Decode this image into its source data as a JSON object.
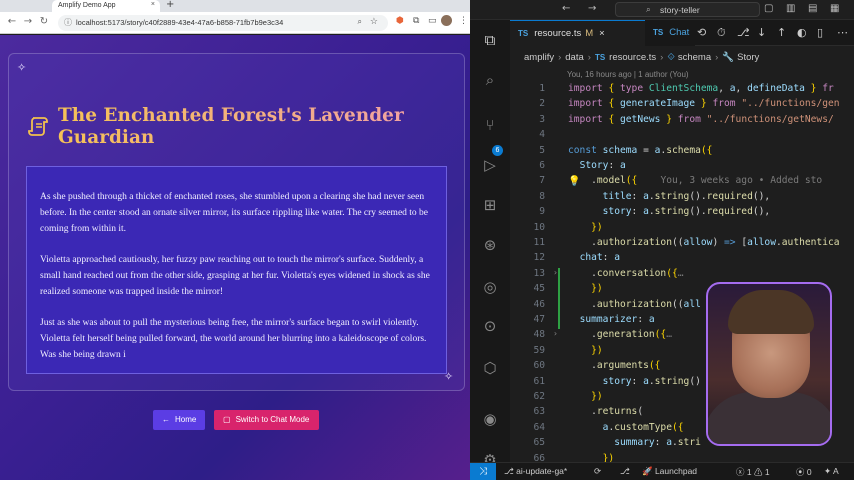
{
  "browser": {
    "tab_title": "Amplify Demo App",
    "tab_close": "×",
    "new_tab": "+",
    "url": "localhost:5173/story/c40f2889-43e4-47a6-b858-71fb7b9e3c34",
    "nav": {
      "back": "←",
      "forward": "→",
      "reload": "↻"
    }
  },
  "app": {
    "title": "The Enchanted Forest's Lavender Guardian",
    "paragraphs": [
      "As she pushed through a thicket of enchanted roses, she stumbled upon a clearing she had never seen before. In the center stood an ornate silver mirror, its surface rippling like water. The cry seemed to be coming from within it.",
      "Violetta approached cautiously, her fuzzy paw reaching out to touch the mirror's surface. Suddenly, a small hand reached out from the other side, grasping at her fur. Violetta's eyes widened in shock as she realized someone was trapped inside the mirror!",
      "Just as she was about to pull the mysterious being free, the mirror's surface began to swirl violently. Violetta felt herself being pulled forward, the world around her blurring into a kaleidoscope of colors. Was she being drawn i"
    ],
    "home_label": "Home",
    "chat_label": "Switch to Chat Mode",
    "colors": {
      "bg": "#3a1f92",
      "home": "#5b3de4",
      "chat": "#d8246c",
      "title_gold": "#f5c256"
    }
  },
  "editor": {
    "search": "story-teller",
    "tab_active": {
      "lang": "TS",
      "name": "resource.ts",
      "modified": "M",
      "close": "×"
    },
    "tab2": {
      "lang": "TS",
      "name": "Chat"
    },
    "breadcrumb": [
      "amplify",
      "data",
      "resource.ts",
      "schema",
      "Story"
    ],
    "breadcrumb_lang": "TS",
    "blame": "You, 16 hours ago | 1 author (You)",
    "scm_badge": "6",
    "lines": [
      {
        "n": "1",
        "segs": [
          [
            "k",
            "import "
          ],
          [
            "p",
            "{ "
          ],
          [
            "k",
            "type "
          ],
          [
            "t",
            "ClientSchema"
          ],
          [
            "d",
            ", "
          ],
          [
            "v",
            "a"
          ],
          [
            "d",
            ", "
          ],
          [
            "v",
            "defineData "
          ],
          [
            "p",
            "} "
          ],
          [
            "k",
            "fr"
          ]
        ]
      },
      {
        "n": "2",
        "segs": [
          [
            "k",
            "import "
          ],
          [
            "p",
            "{ "
          ],
          [
            "v",
            "generateImage "
          ],
          [
            "p",
            "} "
          ],
          [
            "k",
            "from "
          ],
          [
            "s",
            "\"../functions/gen"
          ]
        ]
      },
      {
        "n": "3",
        "segs": [
          [
            "k",
            "import "
          ],
          [
            "p",
            "{ "
          ],
          [
            "v",
            "getNews "
          ],
          [
            "p",
            "} "
          ],
          [
            "k",
            "from "
          ],
          [
            "s",
            "\"../functions/getNews/"
          ]
        ]
      },
      {
        "n": "4",
        "segs": []
      },
      {
        "n": "5",
        "segs": [
          [
            "b",
            "const "
          ],
          [
            "v",
            "schema "
          ],
          [
            "d",
            "= "
          ],
          [
            "v",
            "a"
          ],
          [
            "d",
            "."
          ],
          [
            "f",
            "schema"
          ],
          [
            "p",
            "({"
          ]
        ]
      },
      {
        "n": "6",
        "segs": [
          [
            "d",
            "  "
          ],
          [
            "v",
            "Story"
          ],
          [
            "d",
            ": "
          ],
          [
            "v",
            "a"
          ]
        ]
      },
      {
        "n": "7",
        "segs": [
          [
            "d",
            "    ."
          ],
          [
            "f",
            "model"
          ],
          [
            "p",
            "({"
          ],
          [
            "g",
            "    You, 3 weeks ago • Added sto"
          ]
        ]
      },
      {
        "n": "8",
        "segs": [
          [
            "d",
            "      "
          ],
          [
            "v",
            "title"
          ],
          [
            "d",
            ": "
          ],
          [
            "v",
            "a"
          ],
          [
            "d",
            "."
          ],
          [
            "f",
            "string"
          ],
          [
            "d",
            "()."
          ],
          [
            "f",
            "required"
          ],
          [
            "d",
            "(),"
          ]
        ]
      },
      {
        "n": "9",
        "segs": [
          [
            "d",
            "      "
          ],
          [
            "v",
            "story"
          ],
          [
            "d",
            ": "
          ],
          [
            "v",
            "a"
          ],
          [
            "d",
            "."
          ],
          [
            "f",
            "string"
          ],
          [
            "d",
            "()."
          ],
          [
            "f",
            "required"
          ],
          [
            "d",
            "(),"
          ]
        ]
      },
      {
        "n": "10",
        "segs": [
          [
            "d",
            "    "
          ],
          [
            "p",
            "})"
          ]
        ]
      },
      {
        "n": "11",
        "segs": [
          [
            "d",
            "    ."
          ],
          [
            "f",
            "authorization"
          ],
          [
            "d",
            "(("
          ],
          [
            "v",
            "allow"
          ],
          [
            "d",
            ") "
          ],
          [
            "b",
            "=> "
          ],
          [
            "d",
            "["
          ],
          [
            "v",
            "allow"
          ],
          [
            "d",
            "."
          ],
          [
            "f",
            "authentica"
          ]
        ]
      },
      {
        "n": "12",
        "segs": [
          [
            "d",
            "  "
          ],
          [
            "v",
            "chat"
          ],
          [
            "d",
            ": "
          ],
          [
            "v",
            "a"
          ]
        ]
      },
      {
        "n": "13",
        "segs": [
          [
            "d",
            "    ."
          ],
          [
            "f",
            "conversation"
          ],
          [
            "p",
            "({"
          ],
          [
            "g",
            "…"
          ]
        ],
        "fold": true
      },
      {
        "n": "45",
        "segs": [
          [
            "d",
            "    "
          ],
          [
            "p",
            "})"
          ]
        ]
      },
      {
        "n": "46",
        "segs": [
          [
            "d",
            "    ."
          ],
          [
            "f",
            "authorization"
          ],
          [
            "d",
            "(("
          ],
          [
            "v",
            "all"
          ]
        ]
      },
      {
        "n": "47",
        "segs": [
          [
            "d",
            "  "
          ],
          [
            "v",
            "summarizer"
          ],
          [
            "d",
            ": "
          ],
          [
            "v",
            "a"
          ]
        ]
      },
      {
        "n": "48",
        "segs": [
          [
            "d",
            "    ."
          ],
          [
            "f",
            "generation"
          ],
          [
            "p",
            "({"
          ],
          [
            "g",
            "…"
          ]
        ],
        "fold": true
      },
      {
        "n": "59",
        "segs": [
          [
            "d",
            "    "
          ],
          [
            "p",
            "})"
          ]
        ]
      },
      {
        "n": "60",
        "segs": [
          [
            "d",
            "    ."
          ],
          [
            "f",
            "arguments"
          ],
          [
            "p",
            "({"
          ]
        ]
      },
      {
        "n": "61",
        "segs": [
          [
            "d",
            "      "
          ],
          [
            "v",
            "story"
          ],
          [
            "d",
            ": "
          ],
          [
            "v",
            "a"
          ],
          [
            "d",
            "."
          ],
          [
            "f",
            "string"
          ],
          [
            "d",
            "()"
          ]
        ]
      },
      {
        "n": "62",
        "segs": [
          [
            "d",
            "    "
          ],
          [
            "p",
            "})"
          ]
        ]
      },
      {
        "n": "63",
        "segs": [
          [
            "d",
            "    ."
          ],
          [
            "f",
            "returns"
          ],
          [
            "d",
            "("
          ]
        ]
      },
      {
        "n": "64",
        "segs": [
          [
            "d",
            "      "
          ],
          [
            "v",
            "a"
          ],
          [
            "d",
            "."
          ],
          [
            "f",
            "customType"
          ],
          [
            "p",
            "({"
          ]
        ]
      },
      {
        "n": "65",
        "segs": [
          [
            "d",
            "        "
          ],
          [
            "v",
            "summary"
          ],
          [
            "d",
            ": "
          ],
          [
            "v",
            "a"
          ],
          [
            "d",
            "."
          ],
          [
            "f",
            "stri"
          ]
        ]
      },
      {
        "n": "66",
        "segs": [
          [
            "d",
            "      "
          ],
          [
            "p",
            "})"
          ]
        ]
      }
    ],
    "status": {
      "branch": "ai-update-ga*",
      "launchpad": "Launchpad",
      "errors": "1",
      "warnings": "1",
      "ports": "0",
      "ai": "A"
    }
  }
}
